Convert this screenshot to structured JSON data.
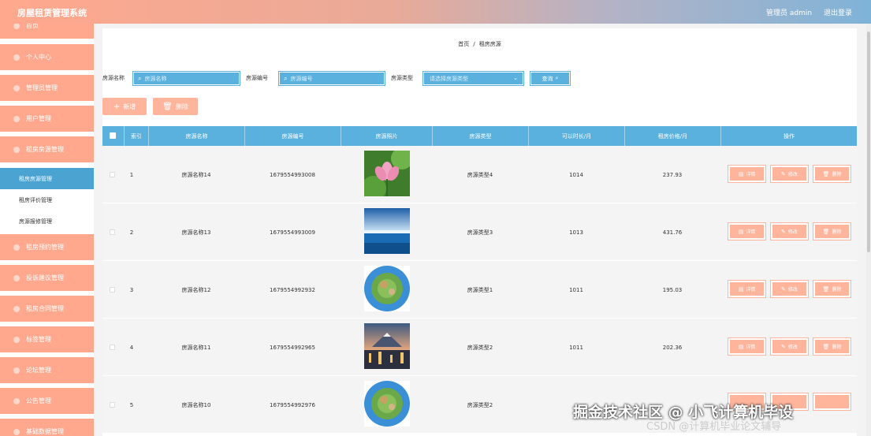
{
  "app": {
    "title": "房屋租赁管理系统",
    "admin": "管理员 admin",
    "logout": "退出登录"
  },
  "colors": {
    "accent": "#ffa88d",
    "primary": "#5ab1dd",
    "button": "#ffb49c"
  },
  "sidebar": {
    "menus_top": [
      "首页",
      "个人中心",
      "管理员管理",
      "用户管理",
      "租房房源管理"
    ],
    "submenus": [
      "租房房源管理",
      "租房评价管理",
      "房源报修管理"
    ],
    "active_submenu": 0,
    "menus_bottom": [
      "租房预约管理",
      "投诉建议管理",
      "租房合同管理",
      "标签管理",
      "论坛管理",
      "公告管理",
      "基础数据管理"
    ]
  },
  "breadcrumb": {
    "home": "首页",
    "separator": "/",
    "current": "租房房源"
  },
  "filters": {
    "name_label": "房源名称",
    "name_placeholder": "房源名称",
    "code_label": "房源编号",
    "code_placeholder": "房源编号",
    "type_label": "房源类型",
    "type_placeholder": "请选择房源类型",
    "query_label": "查询"
  },
  "actions": {
    "add": "新增",
    "delete": "删除"
  },
  "table": {
    "headers": [
      "索引",
      "房源名称",
      "房源编号",
      "房源照片",
      "房源类型",
      "可以时长/月",
      "租房价格/月",
      "操作"
    ],
    "rows": [
      {
        "index": "1",
        "name": "房源名称14",
        "code": "1679554993008",
        "photo": "lotus-flower",
        "type": "房源类型4",
        "duration": "1014",
        "price": "237.93"
      },
      {
        "index": "2",
        "name": "房源名称13",
        "code": "1679554993009",
        "photo": "ocean-sky",
        "type": "房源类型3",
        "duration": "1013",
        "price": "431.76"
      },
      {
        "index": "3",
        "name": "房源名称12",
        "code": "1679554992932",
        "photo": "tiny-planet",
        "type": "房源类型1",
        "duration": "1011",
        "price": "195.03"
      },
      {
        "index": "4",
        "name": "房源名称11",
        "code": "1679554992965",
        "photo": "mountain-city",
        "type": "房源类型2",
        "duration": "1011",
        "price": "202.36"
      },
      {
        "index": "5",
        "name": "房源名称10",
        "code": "1679554992976",
        "photo": "tiny-planet",
        "type": "房源类型2",
        "duration": "",
        "price": ""
      }
    ],
    "row_buttons": {
      "detail": "详情",
      "edit": "修改",
      "delete": "删除"
    }
  },
  "watermark": {
    "line1": "掘金技术社区 @ 小飞计算机毕设",
    "line2": "CSDN @计算机毕业论文辅导"
  }
}
